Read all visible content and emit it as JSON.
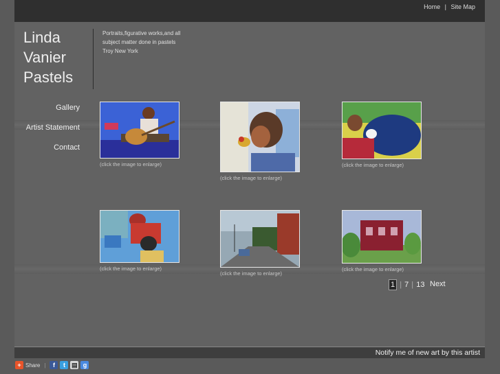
{
  "header": {
    "nav": [
      "Home",
      "Site Map"
    ]
  },
  "site": {
    "title_lines": [
      "Linda",
      "Vanier",
      "Pastels"
    ],
    "tagline_lines": [
      "Portraits,figurative works,and all",
      "subject matter done in pastels",
      "Troy New York"
    ]
  },
  "sidebar": {
    "items": [
      "Gallery",
      "Artist Statement",
      "Contact"
    ]
  },
  "gallery": {
    "caption": "(click the image to enlarge)",
    "thumbnails": [
      {
        "subject": "guitar player"
      },
      {
        "subject": "boy with bird"
      },
      {
        "subject": "sleeping man"
      },
      {
        "subject": "mother and child"
      },
      {
        "subject": "street scene"
      },
      {
        "subject": "red house"
      }
    ]
  },
  "pagination": {
    "current": "1",
    "pages": [
      "7",
      "13"
    ],
    "next": "Next"
  },
  "footer": {
    "notify": "Notify me of new art by this artist",
    "share_label": "Share"
  }
}
